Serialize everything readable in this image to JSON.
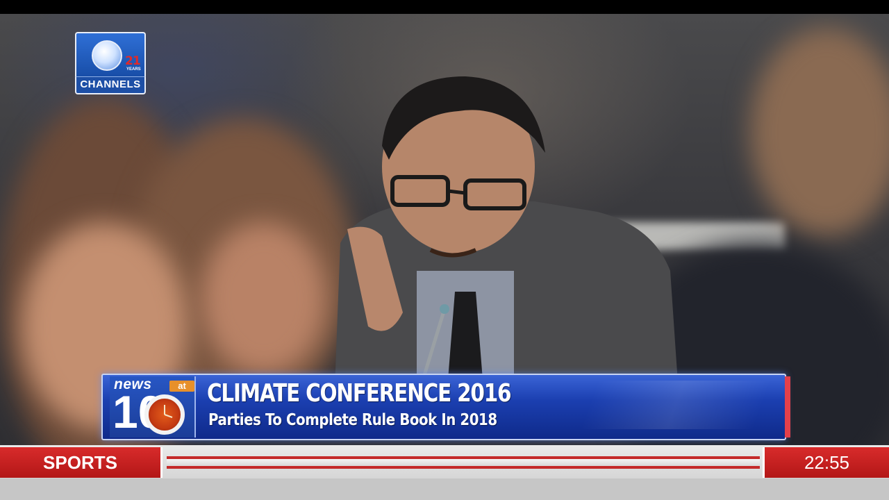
{
  "channel": {
    "name": "CHANNELS",
    "anniversary_number": "21",
    "anniversary_label": "YEARS"
  },
  "program": {
    "name": "news",
    "at": "at",
    "number": "10"
  },
  "lower_third": {
    "headline": "CLIMATE CONFERENCE 2016",
    "subheadline": "Parties To Complete Rule Book In 2018"
  },
  "ticker": {
    "section_label": "SPORTS",
    "time": "22:55"
  },
  "colors": {
    "lower_third_blue": "#1b3fb0",
    "ticker_red": "#c42a2a",
    "badge_orange": "#e7902a"
  }
}
